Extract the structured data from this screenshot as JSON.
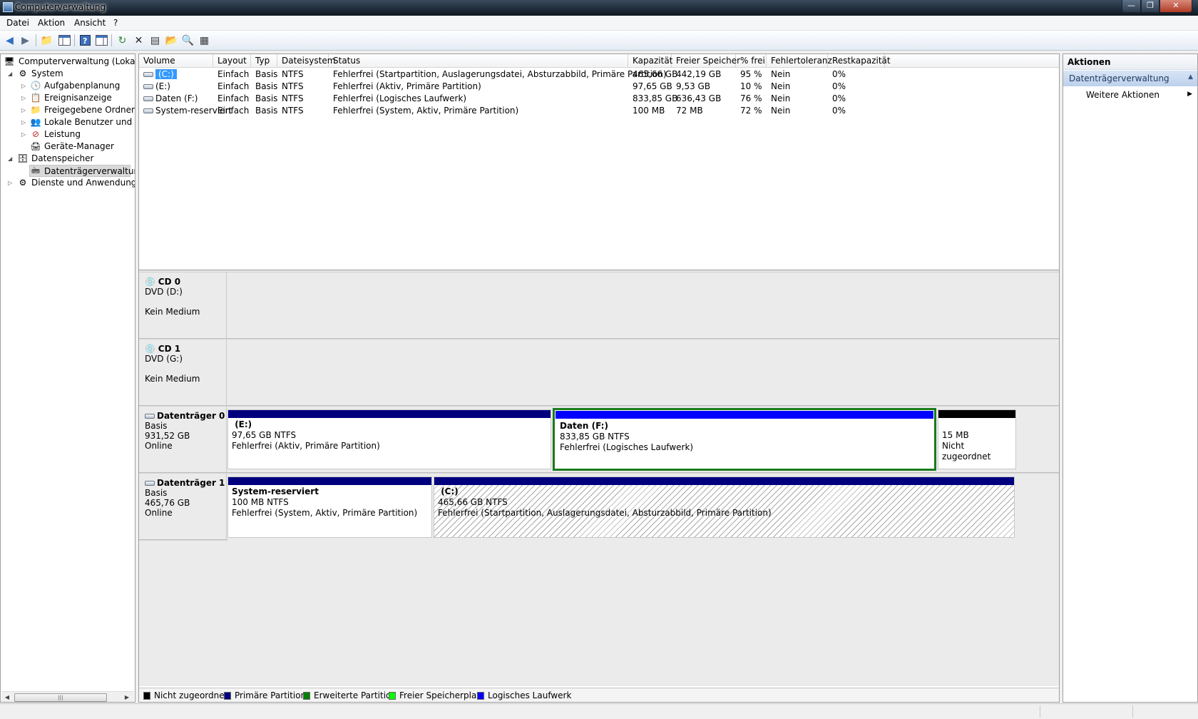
{
  "window": {
    "title": "Computerverwaltung"
  },
  "menu": [
    "Datei",
    "Aktion",
    "Ansicht",
    "?"
  ],
  "toolbar_icons": [
    "back-arrow-icon",
    "forward-arrow-icon",
    "up-folder-icon",
    "show-hide-tree-icon",
    "help-icon",
    "show-hide-action-pane-icon",
    "refresh-icon",
    "delete-icon",
    "properties-icon",
    "open-icon",
    "search-icon",
    "export-icon"
  ],
  "tree": {
    "root": "Computerverwaltung (Lokal)",
    "system": "System",
    "aufgaben": "Aufgabenplanung",
    "ereignis": "Ereignisanzeige",
    "freigaben": "Freigegebene Ordner",
    "benutzer": "Lokale Benutzer und Gr",
    "leistung": "Leistung",
    "geraete": "Geräte-Manager",
    "datenspeicher": "Datenspeicher",
    "datentraeger": "Datenträgerverwaltung",
    "dienste": "Dienste und Anwendungen"
  },
  "volume_table": {
    "headers": [
      "Volume",
      "Layout",
      "Typ",
      "Dateisystem",
      "Status",
      "Kapazität",
      "Freier Speicher",
      "% frei",
      "Fehlertoleranz",
      "Restkapazität"
    ],
    "rows": [
      [
        "(C:)",
        "Einfach",
        "Basis",
        "NTFS",
        "Fehlerfrei (Startpartition, Auslagerungsdatei, Absturzabbild, Primäre Partition)",
        "465,66 GB",
        "442,19 GB",
        "95 %",
        "Nein",
        "0%"
      ],
      [
        "(E:)",
        "Einfach",
        "Basis",
        "NTFS",
        "Fehlerfrei (Aktiv, Primäre Partition)",
        "97,65 GB",
        "9,53 GB",
        "10 %",
        "Nein",
        "0%"
      ],
      [
        "Daten (F:)",
        "Einfach",
        "Basis",
        "NTFS",
        "Fehlerfrei (Logisches Laufwerk)",
        "833,85 GB",
        "636,43 GB",
        "76 %",
        "Nein",
        "0%"
      ],
      [
        "System-reserviert",
        "Einfach",
        "Basis",
        "NTFS",
        "Fehlerfrei (System, Aktiv, Primäre Partition)",
        "100 MB",
        "72 MB",
        "72 %",
        "Nein",
        "0%"
      ]
    ]
  },
  "disks": {
    "cd0": {
      "name": "CD 0",
      "type": "DVD (D:)",
      "status": "Kein Medium"
    },
    "cd1": {
      "name": "CD 1",
      "type": "DVD (G:)",
      "status": "Kein Medium"
    },
    "d0": {
      "name": "Datenträger 0",
      "type": "Basis",
      "size": "931,52 GB",
      "status": "Online",
      "p1": {
        "name": "(E:)",
        "size": "97,65 GB NTFS",
        "status": "Fehlerfrei (Aktiv, Primäre Partition)",
        "color": "#00007f"
      },
      "p2": {
        "name": "Daten  (F:)",
        "size": "833,85 GB NTFS",
        "status": "Fehlerfrei (Logisches Laufwerk)",
        "color": "#0000ff",
        "border_color": "#1a7a1a"
      },
      "p3": {
        "size": "15 MB",
        "status": "Nicht zugeordnet",
        "color": "#000000"
      }
    },
    "d1": {
      "name": "Datenträger 1",
      "type": "Basis",
      "size": "465,76 GB",
      "status": "Online",
      "p1": {
        "name": "System-reserviert",
        "size": "100 MB NTFS",
        "status": "Fehlerfrei (System, Aktiv, Primäre Partition)",
        "color": "#00007f"
      },
      "p2": {
        "name": "(C:)",
        "size": "465,66 GB NTFS",
        "status": "Fehlerfrei (Startpartition, Auslagerungsdatei, Absturzabbild, Primäre Partition)",
        "color": "#00007f"
      }
    }
  },
  "legend": [
    {
      "label": "Nicht zugeordnet",
      "color": "#000000"
    },
    {
      "label": "Primäre Partition",
      "color": "#00007f"
    },
    {
      "label": "Erweiterte Partition",
      "color": "#007f00"
    },
    {
      "label": "Freier Speicherplatz",
      "color": "#00ff00"
    },
    {
      "label": "Logisches Laufwerk",
      "color": "#0000ff"
    }
  ],
  "actions": {
    "title": "Aktionen",
    "section": "Datenträgerverwaltung",
    "more": "Weitere Aktionen"
  }
}
